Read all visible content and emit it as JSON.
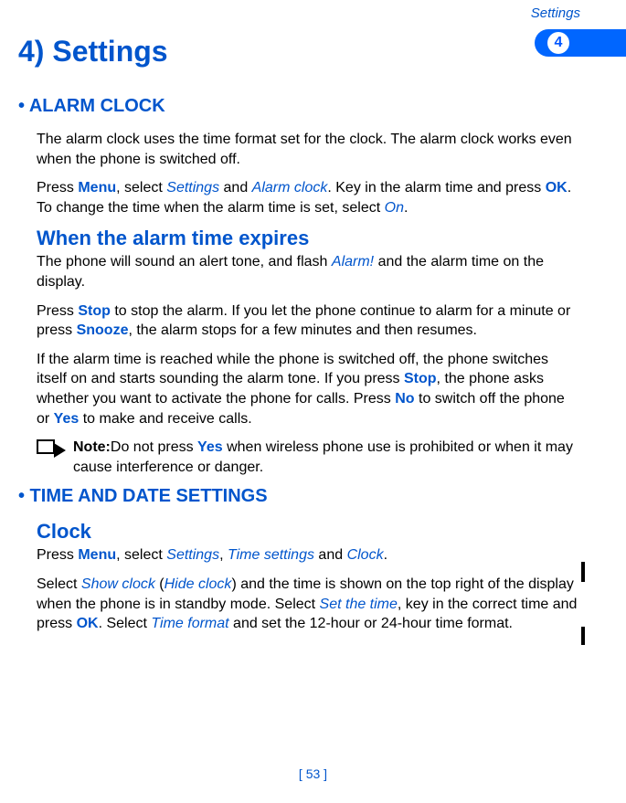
{
  "header": {
    "section_label": "Settings"
  },
  "tab": {
    "chapter_number": "4"
  },
  "chapter": {
    "title": "4) Settings"
  },
  "alarm": {
    "heading": "• ALARM CLOCK",
    "p1_a": "The alarm clock uses the time format set for the clock. The alarm clock works even when the phone is switched off.",
    "p2_pre": "Press ",
    "menu": "Menu",
    "p2_b": ", select ",
    "settings": "Settings",
    "p2_c": " and ",
    "alarmclock": "Alarm clock",
    "p2_d": ". Key in the alarm time and press ",
    "ok": "OK",
    "p2_e": ". To change the time when the alarm time is set, select ",
    "on": "On",
    "p2_f": ".",
    "sub1_title": "When the alarm time expires",
    "p3_a": "The phone will sound an alert tone, and flash ",
    "alarm_flash": "Alarm!",
    "p3_b": " and the alarm time on the display.",
    "p4_a": "Press ",
    "stop": "Stop",
    "p4_b": " to stop the alarm. If you let the phone continue to alarm for a minute or press ",
    "snooze": "Snooze",
    "p4_c": ", the alarm stops for a few minutes and then resumes.",
    "p5_a": "If the alarm time is reached while the phone is switched off, the phone switches itself on and starts sounding the alarm tone. If you press ",
    "p5_b": ", the phone asks whether you want to activate the phone for calls.  Press ",
    "no": "No",
    "p5_c": " to switch off the phone or ",
    "yes": "Yes",
    "p5_d": " to make and receive calls.",
    "note_label": "Note:",
    "note_a": "Do not press ",
    "note_b": " when wireless phone use is prohibited or when it may cause interference or danger."
  },
  "timedate": {
    "heading": "• TIME AND DATE SETTINGS",
    "clock_title": "Clock",
    "p1_a": "Press ",
    "menu": "Menu",
    "p1_b": ", select ",
    "settings": "Settings",
    "p1_c": ", ",
    "timesettings": "Time settings",
    "p1_d": " and ",
    "clock": "Clock",
    "p1_e": ".",
    "p2_a": "Select ",
    "showclock": "Show clock",
    "p2_b": " (",
    "hideclock": "Hide clock",
    "p2_c": ") and the time is shown on the top right of the display when the phone is in standby mode. Select ",
    "setthetime": "Set the time",
    "p2_d": ", key in the correct time and press ",
    "ok": "OK",
    "p2_e": ". Select ",
    "timeformat": "Time format",
    "p2_f": " and set the 12-hour or 24-hour time format."
  },
  "footer": {
    "page_label": "[ 53 ]"
  }
}
